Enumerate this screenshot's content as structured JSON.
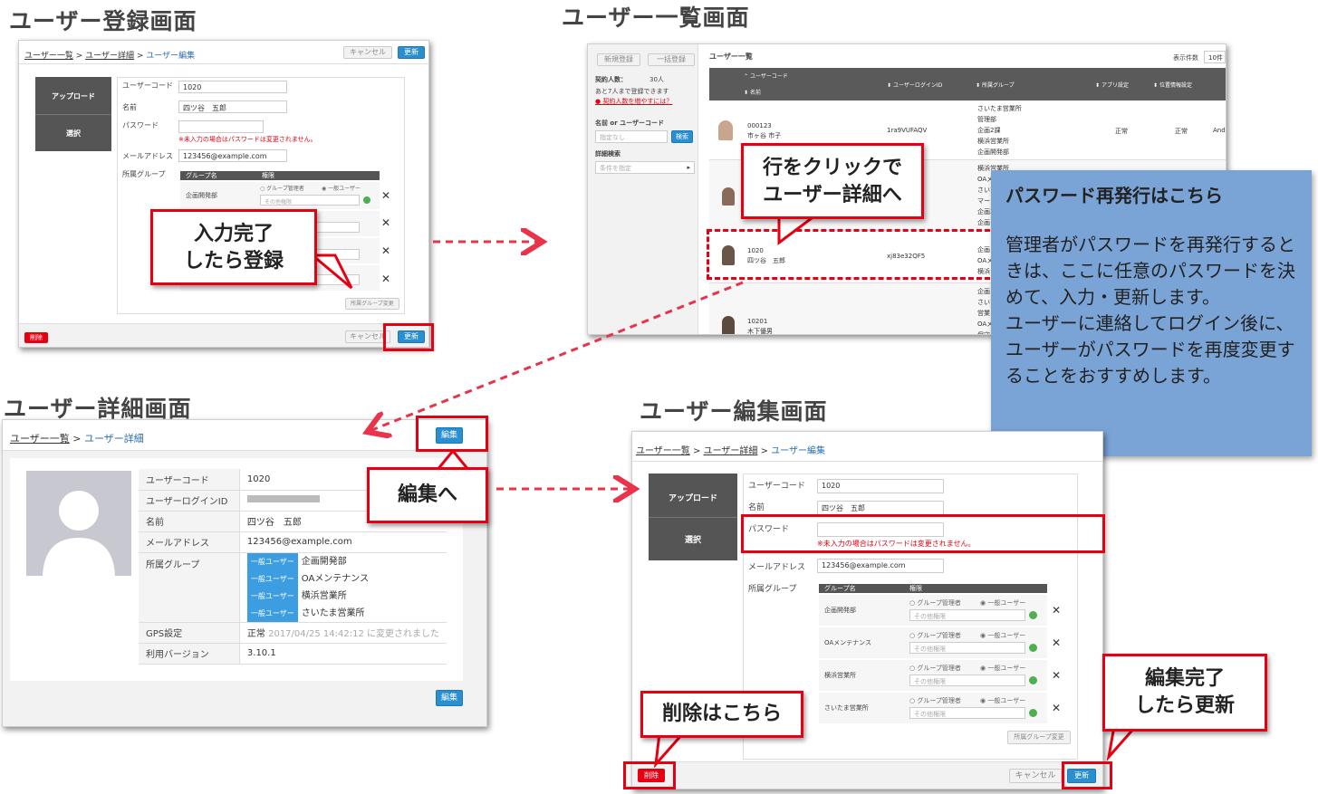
{
  "titles": {
    "register": "ユーザー登録画面",
    "list": "ユーザー一覧画面",
    "detail": "ユーザー詳細画面",
    "edit": "ユーザー編集画面"
  },
  "register": {
    "bc_list": "ユーザー一覧",
    "bc_detail": "ユーザー詳細",
    "bc_edit": "ユーザー編集",
    "sep": ">",
    "cancel": "キャンセル",
    "update": "更新",
    "upload": "アップロード",
    "select": "選択",
    "labels": {
      "code": "ユーザーコード",
      "name": "名前",
      "password": "パスワード",
      "email": "メールアドレス",
      "group": "所属グループ"
    },
    "values": {
      "code": "1020",
      "name": "四ツ谷　五郎",
      "email": "123456@example.com"
    },
    "pw_note": "※未入力の場合はパスワードは変更されません。",
    "grp_col": "グループ名",
    "perm_col": "権限",
    "group1": "企画開発部",
    "radio_admin": "グループ管理者",
    "radio_user": "一般ユーザー",
    "other_perm": "その他権限",
    "grp_change": "所属グループ変更",
    "delete": "削除"
  },
  "callouts": {
    "register_done": "入力完了\nしたら登録",
    "row_click": "行をクリックで\nユーザー詳細へ",
    "to_edit": "編集へ",
    "delete_here": "削除はこちら",
    "edit_done": "編集完了\nしたら更新"
  },
  "list": {
    "new_reg": "新規登録",
    "bulk_reg": "一括登録",
    "title": "ユーザー一覧",
    "per_page_label": "表示件数",
    "per_page": "10件",
    "contract_label": "契約人数：",
    "contract_value": "30人",
    "remain": "あと7人まで登録できます",
    "increase_link": "契約人数を増やすには？",
    "search_label": "名前 or ユーザーコード",
    "search_placeholder": "指定なし",
    "search_btn": "検索",
    "detail_search": "詳細検索",
    "condition": "条件を指定",
    "col_code": "ユーザーコード",
    "col_name": "名前",
    "col_login": "ユーザーログインID",
    "col_group": "所属グループ",
    "col_app": "アプリ設定",
    "col_gps": "位置情報設定",
    "rows": [
      {
        "code": "000123",
        "name": "市ヶ谷 市子",
        "login": "1ra9VUFAQV",
        "groups": [
          "さいたま営業所",
          "管理部",
          "企画2課",
          "横浜営業所",
          "企画開発部"
        ],
        "app": "正常",
        "gps": "正常",
        "extra": "Andr"
      },
      {
        "code": "",
        "name": "",
        "login": "",
        "groups": [
          "横浜営業所",
          "OAメ",
          "さいた",
          "マー",
          "企画2",
          "企画"
        ],
        "app": "",
        "gps": "",
        "extra": ""
      },
      {
        "code": "1020",
        "name": "四ツ谷　五郎",
        "login": "xj83e32QF5",
        "groups": [
          "企画",
          "OAメ",
          "横浜"
        ],
        "app": "",
        "gps": "",
        "extra": ""
      },
      {
        "code": "10201",
        "name": "木下優男",
        "login": "",
        "groups": [
          "企画",
          "さいた",
          "営業",
          "OAメ",
          "保守"
        ],
        "app": "",
        "gps": "",
        "extra": ""
      }
    ]
  },
  "password_note": {
    "title": "パスワード再発行はこちら",
    "body": "管理者がパスワードを再発行するときは、ここに任意のパスワードを決めて、入力・更新します。\nユーザーに連絡してログイン後に、ユーザーがパスワードを再度変更することをおすすめします。"
  },
  "detail": {
    "bc_list": "ユーザー一覧",
    "bc_detail": "ユーザー詳細",
    "sep": ">",
    "edit_btn": "編集",
    "rows": [
      {
        "k": "ユーザーコード",
        "v": "1020"
      },
      {
        "k": "ユーザーログインID",
        "v": ""
      },
      {
        "k": "名前",
        "v": "四ツ谷　五郎"
      },
      {
        "k": "メールアドレス",
        "v": "123456@example.com"
      }
    ],
    "group_label": "所属グループ",
    "tag": "一般ユーザー",
    "groups": [
      "企画開発部",
      "OAメンテナンス",
      "横浜営業所",
      "さいたま営業所"
    ],
    "gps_label": "GPS設定",
    "gps_value": "正常",
    "gps_note": "2017/04/25 14:42:12 に変更されました",
    "ver_label": "利用バージョン",
    "ver_value": "3.10.1"
  },
  "edit": {
    "bc_list": "ユーザー一覧",
    "bc_detail": "ユーザー詳細",
    "bc_edit": "ユーザー編集",
    "sep": ">",
    "upload": "アップロード",
    "select": "選択",
    "labels": {
      "code": "ユーザーコード",
      "name": "名前",
      "password": "パスワード",
      "email": "メールアドレス",
      "group": "所属グループ"
    },
    "values": {
      "code": "1020",
      "name": "四ツ谷　五郎",
      "email": "123456@example.com"
    },
    "pw_note": "※未入力の場合はパスワードは変更されません。",
    "grp_col": "グループ名",
    "perm_col": "権限",
    "groups": [
      "企画開発部",
      "OAメンテナンス",
      "横浜営業所",
      "さいたま営業所"
    ],
    "radio_admin": "グループ管理者",
    "radio_user": "一般ユーザー",
    "other_perm": "その他権限",
    "grp_change": "所属グループ変更",
    "delete": "削除",
    "cancel": "キャンセル",
    "update": "更新"
  },
  "colors": {
    "accent_red": "#e60012",
    "blue": "#2a8fd0",
    "note_bg": "#7aa3d6"
  }
}
